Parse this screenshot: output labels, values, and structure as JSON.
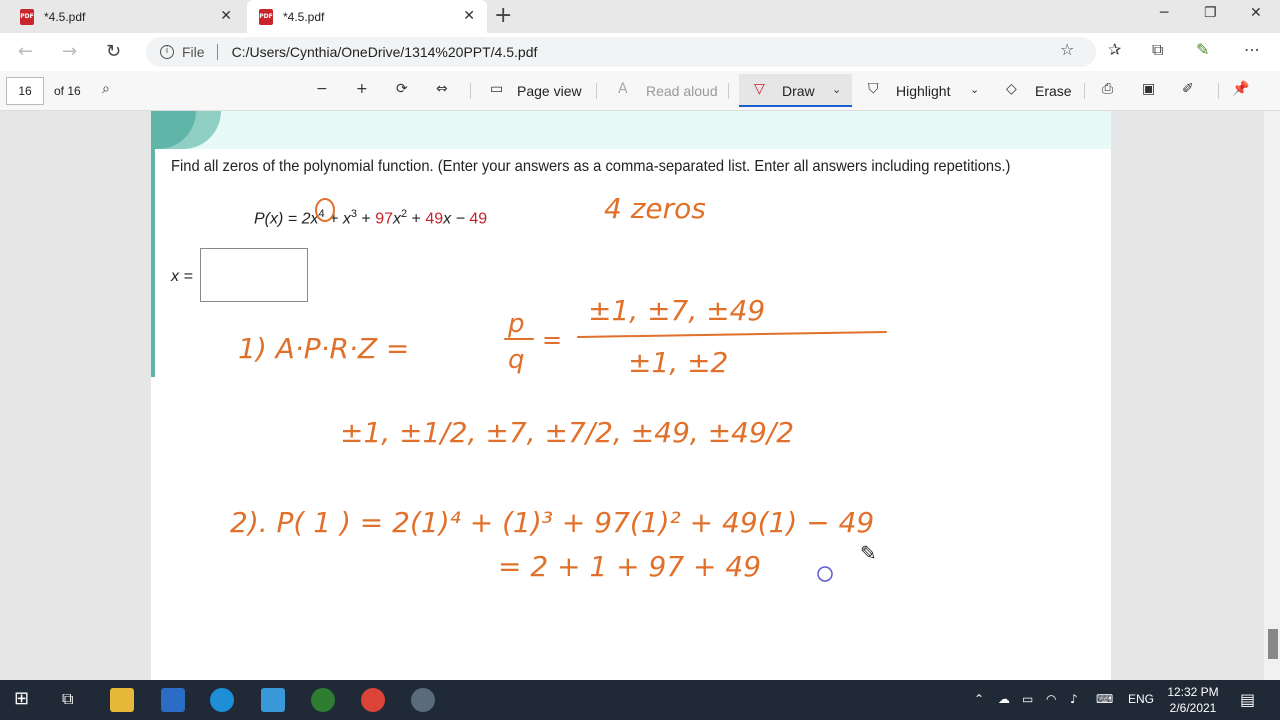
{
  "tabs": [
    {
      "label": "*4.5.pdf",
      "icon": "pdf-file-icon",
      "active": false
    },
    {
      "label": "*4.5.pdf",
      "icon": "pdf-file-icon",
      "active": true
    }
  ],
  "address_bar": {
    "scheme_label": "File",
    "url": "C:/Users/Cynthia/OneDrive/1314%20PPT/4.5.pdf"
  },
  "pdf_toolbar": {
    "page_number": "16",
    "page_total": "of 16",
    "page_view": "Page view",
    "read_aloud": "Read aloud",
    "draw": "Draw",
    "highlight": "Highlight",
    "erase": "Erase"
  },
  "document": {
    "question": "Find all zeros of the polynomial function. (Enter your answers as a comma-separated list. Enter all answers including repetitions.)",
    "polynomial": {
      "lhs": "P(x) = 2x",
      "exp4": "4",
      "t2": " + x",
      "exp3": "3",
      "t3": " + ",
      "c97": "97",
      "t4": "x",
      "exp2": "2",
      "t5": " + ",
      "c49a": "49",
      "t6": "x − ",
      "c49b": "49"
    },
    "answer_label": "x =",
    "answer_value": ""
  },
  "handwriting": {
    "note_zeros": "4 zeros",
    "step1_label": "1)  A·P·R·Z  =",
    "p_over_q_p": "p",
    "p_over_q_q": "q",
    "numerator": "±1, ±7, ±49",
    "denominator": "±1, ±2",
    "candidates": "±1,  ±1/2,  ±7,  ±7/2,  ±49,  ±49/2",
    "step2_line1": "2).   P( 1 ) = 2(1)⁴ + (1)³ + 97(1)² + 49(1) − 49",
    "step2_line2": "= 2 + 1 + 97 + 49"
  },
  "colors": {
    "ink": "#e0702a",
    "red_coeff": "#c8202a",
    "teal": "#5fb5a7",
    "accent_blue": "#1a5fd0"
  },
  "taskbar": {
    "lang": "ENG",
    "time": "12:32 PM",
    "date": "2/6/2021"
  }
}
